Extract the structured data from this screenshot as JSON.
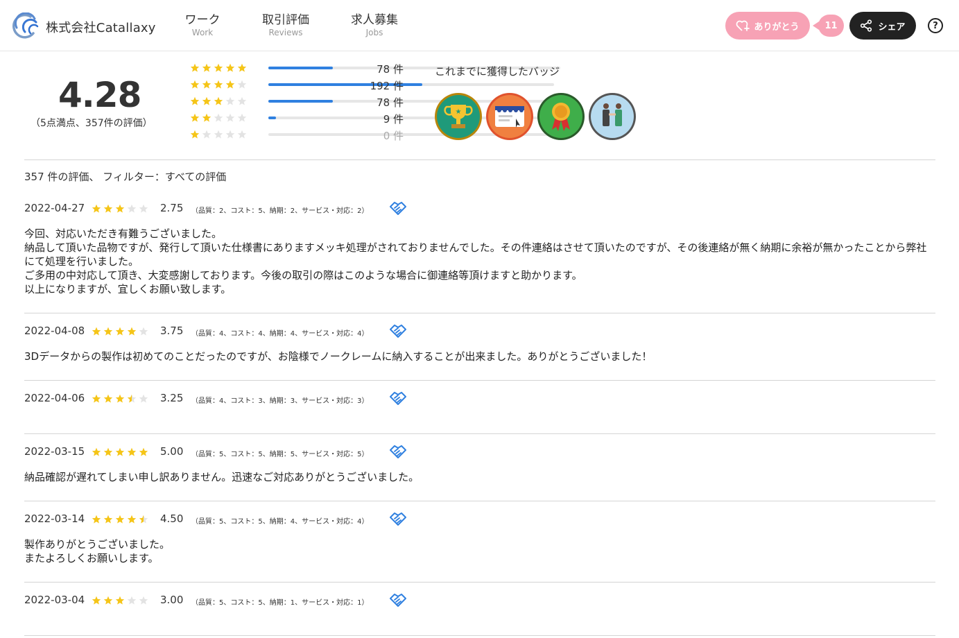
{
  "header": {
    "company": "株式会社Catallaxy",
    "nav": [
      {
        "jp": "ワーク",
        "en": "Work"
      },
      {
        "jp": "取引評価",
        "en": "Reviews"
      },
      {
        "jp": "求人募集",
        "en": "Jobs"
      }
    ],
    "thanks_label": "ありがとう",
    "thanks_count": "11",
    "share_label": "シェア",
    "help_label": "?"
  },
  "colors": {
    "accent_blue": "#2f80e0",
    "star_gold": "#f5c518",
    "star_empty": "#e3e3e3",
    "thanks_pink": "#f7a2b5",
    "share_dark": "#222222"
  },
  "summary": {
    "score": "4.28",
    "subtitle": "（5点満点、357件の評価）",
    "distribution": [
      {
        "stars": 5,
        "count": "78 件",
        "fraction": 0.22
      },
      {
        "stars": 4,
        "count": "192 件",
        "fraction": 0.54
      },
      {
        "stars": 3,
        "count": "78 件",
        "fraction": 0.22
      },
      {
        "stars": 2,
        "count": "9 件",
        "fraction": 0.025
      },
      {
        "stars": 1,
        "count": "0 件",
        "fraction": 0
      }
    ],
    "badges_title": "これまでに獲得したバッジ",
    "badges": [
      "trophy-badge",
      "store-badge",
      "medal-badge",
      "handshake-badge"
    ]
  },
  "filter_text": "357 件の評価、 フィルター：すべての評価",
  "reviews": [
    {
      "date": "2022-04-27",
      "rating": 2.75,
      "score": "2.75",
      "detail": "（品質：2、コスト：5、納期：2、サービス・対応：2）",
      "body": [
        "今回、対応いただき有難うございました。",
        "納品して頂いた品物ですが、発行して頂いた仕様書にありますメッキ処理がされておりませんでした。その件連絡はさせて頂いたのですが、その後連絡が無く納期に余裕が無かったことから弊社にて処理を行いました。",
        "ご多用の中対応して頂き、大変感謝しております。今後の取引の際はこのような場合に御連絡等頂けますと助かります。",
        "以上になりますが、宜しくお願い致します。"
      ]
    },
    {
      "date": "2022-04-08",
      "rating": 3.75,
      "score": "3.75",
      "detail": "（品質：4、コスト：4、納期：4、サービス・対応：4）",
      "body": [
        "3Dデータからの製作は初めてのことだったのですが、お陰様でノークレームに納入することが出来ました。ありがとうございました！"
      ]
    },
    {
      "date": "2022-04-06",
      "rating": 3.25,
      "score": "3.25",
      "detail": "（品質：4、コスト：3、納期：3、サービス・対応：3）",
      "body": []
    },
    {
      "date": "2022-03-15",
      "rating": 5.0,
      "score": "5.00",
      "detail": "（品質：5、コスト：5、納期：5、サービス・対応：5）",
      "body": [
        "納品確認が遅れてしまい申し訳ありません。迅速なご対応ありがとうございました。"
      ]
    },
    {
      "date": "2022-03-14",
      "rating": 4.5,
      "score": "4.50",
      "detail": "（品質：5、コスト：5、納期：4、サービス・対応：4）",
      "body": [
        "製作ありがとうございました。",
        "またよろしくお願いします。"
      ]
    },
    {
      "date": "2022-03-04",
      "rating": 3.0,
      "score": "3.00",
      "detail": "（品質：5、コスト：5、納期：1、サービス・対応：1）",
      "body": []
    }
  ]
}
